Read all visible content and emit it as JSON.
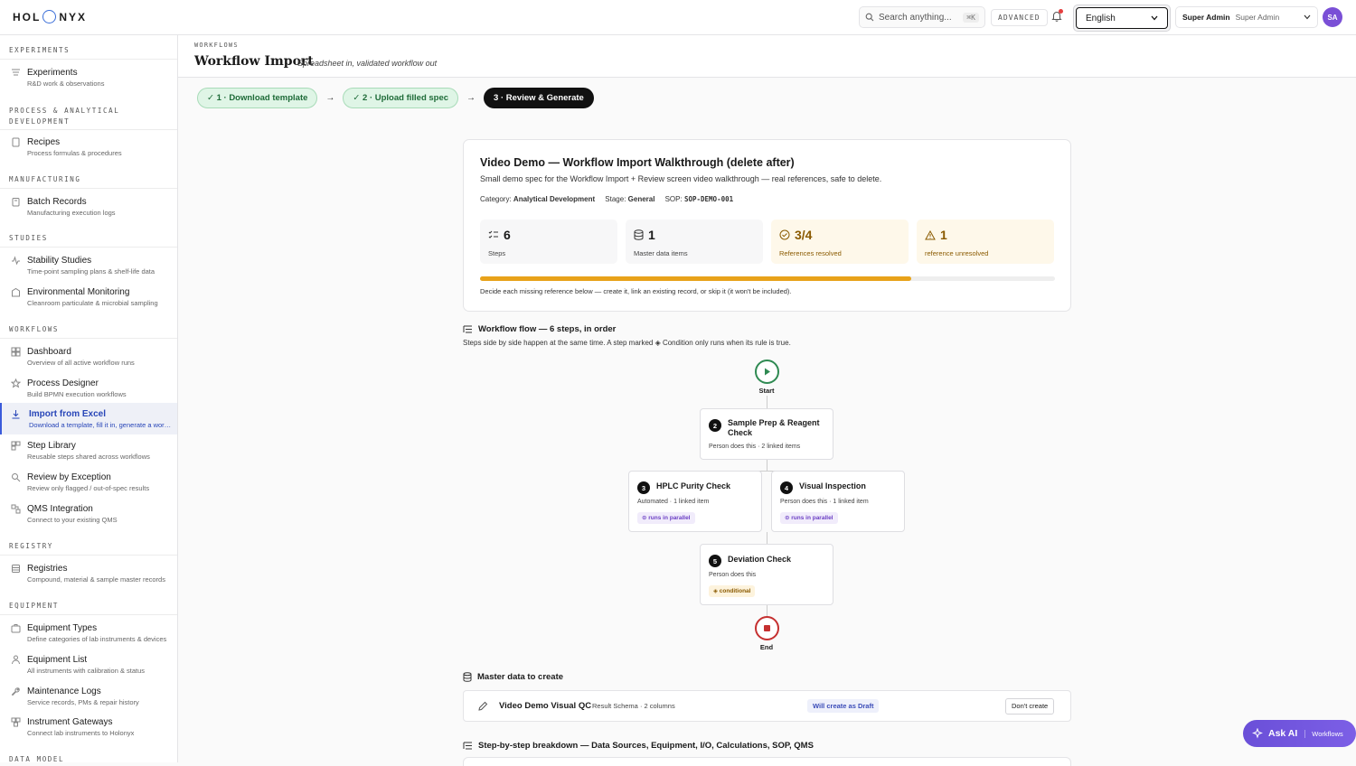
{
  "app": {
    "logo_left": "HOL",
    "logo_right": "NYX"
  },
  "topbar": {
    "search_placeholder": "Search anything...",
    "search_shortcut": "⌘K",
    "advanced_label": "ADVANCED",
    "language": "English",
    "user_role": "Super Admin",
    "user_name": "Super Admin",
    "avatar_initials": "SA",
    "brand_color": "#7a4fd6"
  },
  "sidebar": {
    "sections": [
      {
        "label": "EXPERIMENTS"
      },
      {
        "label": "PROCESS & ANALYTICAL DEVELOPMENT"
      },
      {
        "label": "MANUFACTURING"
      },
      {
        "label": "STUDIES"
      },
      {
        "label": "WORKFLOWS"
      },
      {
        "label": "REGISTRY"
      },
      {
        "label": "EQUIPMENT"
      },
      {
        "label": "DATA MODEL"
      }
    ],
    "items": [
      {
        "label": "Experiments",
        "desc": "R&D work & observations",
        "icon": "flask-icon"
      },
      {
        "label": "Recipes",
        "desc": "Process formulas & procedures",
        "icon": "recipe-icon"
      },
      {
        "label": "Batch Records",
        "desc": "Manufacturing execution logs",
        "icon": "clipboard-icon"
      },
      {
        "label": "Stability Studies",
        "desc": "Time-point sampling plans & shelf-life data",
        "icon": "pulse-icon"
      },
      {
        "label": "Environmental Monitoring",
        "desc": "Cleanroom particulate & microbial sampling",
        "icon": "building-icon"
      },
      {
        "label": "Dashboard",
        "desc": "Overview of all active workflow runs",
        "icon": "grid-icon"
      },
      {
        "label": "Process Designer",
        "desc": "Build BPMN execution workflows",
        "icon": "star-icon"
      },
      {
        "label": "Import from Excel",
        "desc": "Download a template, fill it in, generate a workflow",
        "icon": "download-icon"
      },
      {
        "label": "Step Library",
        "desc": "Reusable steps shared across workflows",
        "icon": "library-icon"
      },
      {
        "label": "Review by Exception",
        "desc": "Review only flagged / out-of-spec results",
        "icon": "search-check-icon"
      },
      {
        "label": "QMS Integration",
        "desc": "Connect to your existing QMS",
        "icon": "plug-icon"
      },
      {
        "label": "Registries",
        "desc": "Compound, material & sample master records",
        "icon": "registry-icon"
      },
      {
        "label": "Equipment Types",
        "desc": "Define categories of lab instruments & devices",
        "icon": "box-icon"
      },
      {
        "label": "Equipment List",
        "desc": "All instruments with calibration & status",
        "icon": "list-icon"
      },
      {
        "label": "Maintenance Logs",
        "desc": "Service records, PMs & repair history",
        "icon": "wrench-icon"
      },
      {
        "label": "Instrument Gateways",
        "desc": "Connect lab instruments to Holonyx",
        "icon": "gateway-icon"
      }
    ]
  },
  "page": {
    "breadcrumb": "WORKFLOWS",
    "title": "Workflow Import",
    "subtitle": "Spreadsheet in, validated workflow out",
    "steps": [
      {
        "label": "✓ 1 · Download template"
      },
      {
        "label": "✓ 2 · Upload filled spec"
      },
      {
        "label": "3 · Review & Generate"
      }
    ],
    "arrow": "→"
  },
  "summary": {
    "title": "Video Demo — Workflow Import Walkthrough (delete after)",
    "description": "Small demo spec for the Workflow Import + Review screen video walkthrough — real references, safe to delete.",
    "category_label": "Category:",
    "category": "Analytical Development",
    "stage_label": "Stage:",
    "stage": "General",
    "sop_label": "SOP:",
    "sop": "SOP-DEMO-001",
    "stats": [
      {
        "value": "6",
        "label": "Steps"
      },
      {
        "value": "1",
        "label": "Master data items"
      },
      {
        "value": "3/4",
        "label": "References resolved"
      },
      {
        "value": "1",
        "label": "reference unresolved"
      }
    ],
    "progress": 0.75,
    "hint": "Decide each missing reference below — create it, link an existing record, or skip it (it won't be included)."
  },
  "flow": {
    "heading": "Workflow flow — 6 steps, in order",
    "subtitle": "Steps side by side happen at the same time. A step marked ◈ Condition only runs when its rule is true.",
    "start_label": "Start",
    "end_label": "End",
    "nodes": [
      {
        "num": "2",
        "name": "Sample Prep & Reagent Check",
        "desc": "Person does this · 2 linked items"
      },
      {
        "num": "3",
        "name": "HPLC Purity Check",
        "desc": "Automated · 1 linked item",
        "tag": "⊙ runs in parallel"
      },
      {
        "num": "4",
        "name": "Visual Inspection",
        "desc": "Person does this · 1 linked item",
        "tag": "⊙ runs in parallel"
      },
      {
        "num": "5",
        "name": "Deviation Check",
        "desc": "Person does this",
        "tag": "◈ conditional"
      }
    ]
  },
  "master": {
    "heading": "Master data to create",
    "item_name": "Video Demo Visual QC",
    "item_type": "Result Schema · 2 columns",
    "badge": "Will create as Draft",
    "button": "Don't create"
  },
  "breakdown": {
    "heading": "Step-by-step breakdown — Data Sources, Equipment, I/O, Calculations, SOP, QMS"
  },
  "askai": {
    "label": "Ask AI",
    "context": "Workflows"
  }
}
